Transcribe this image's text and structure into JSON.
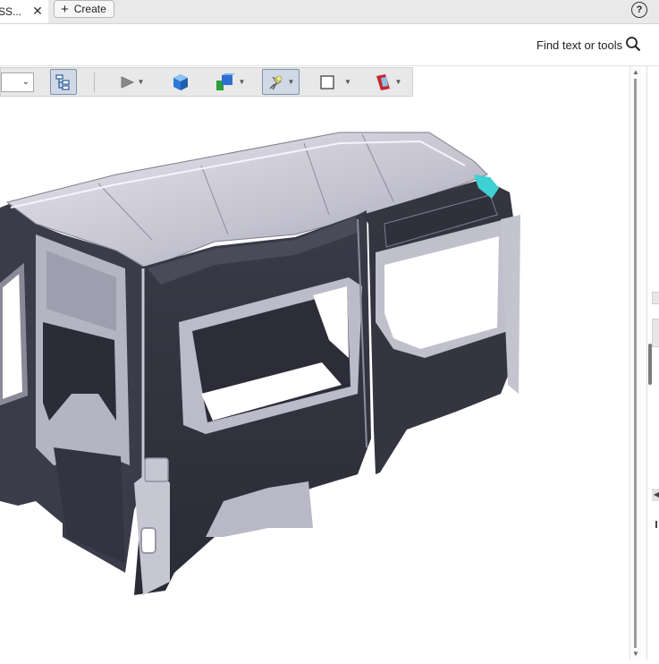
{
  "tabs": [
    {
      "title": "SS..."
    }
  ],
  "tab_close_glyph": "✕",
  "create_button": {
    "icon": "plus-icon",
    "label": "Create"
  },
  "help": {
    "glyph": "?",
    "icon": "help-icon"
  },
  "search": {
    "label": "Find text or tools",
    "icon": "search-icon"
  },
  "toolbar_3d": {
    "tools": [
      {
        "name": "model-tree-icon",
        "active": true
      },
      {
        "name": "play-animation-icon",
        "has_menu": true
      },
      {
        "name": "default-view-cube-icon"
      },
      {
        "name": "render-mode-icon",
        "has_menu": true
      },
      {
        "name": "lighting-icon",
        "active": true,
        "has_menu": true
      },
      {
        "name": "background-color-icon",
        "has_menu": true
      },
      {
        "name": "cross-section-icon",
        "has_menu": true
      }
    ]
  },
  "colors": {
    "panel_shadow": "#2e2f3a",
    "panel_light": "#b4b3c2",
    "roof": "#c9c8d3",
    "accent_cyan": "#3fd0d4"
  }
}
